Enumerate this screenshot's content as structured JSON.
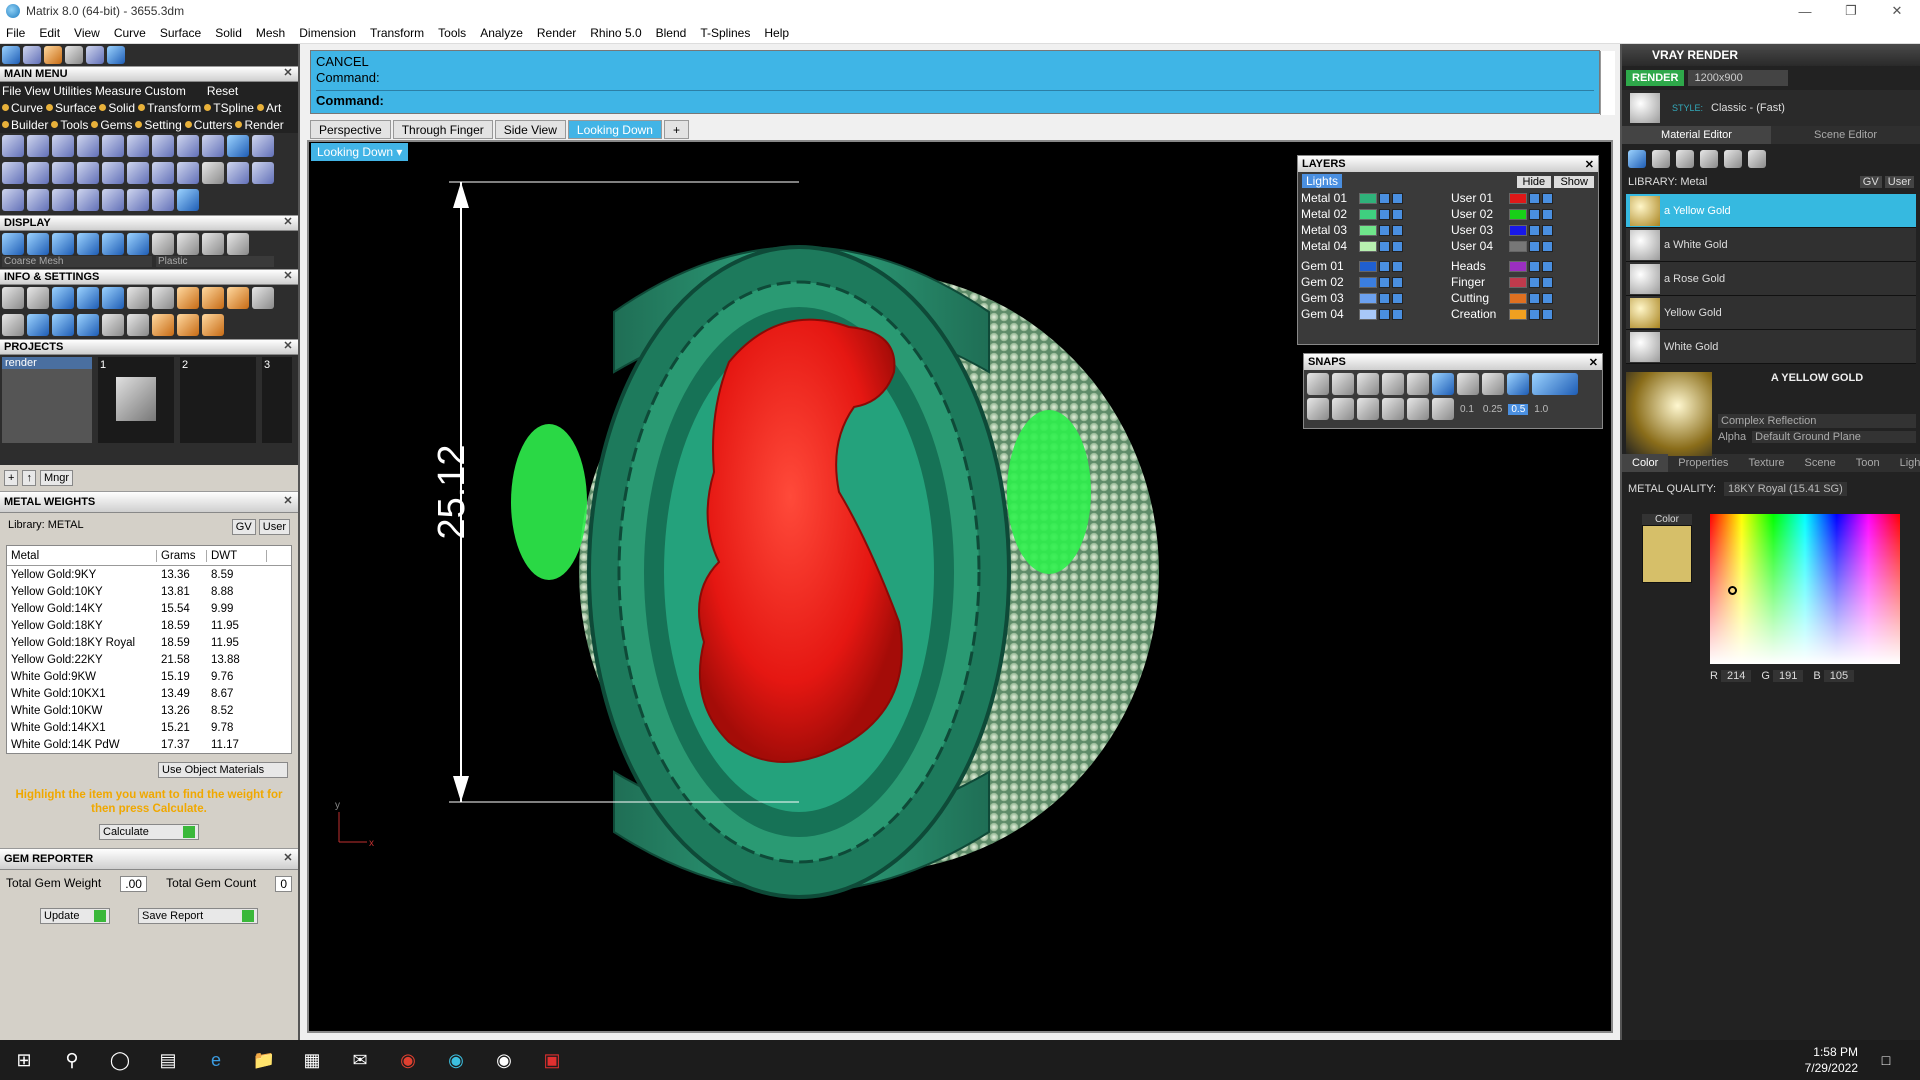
{
  "window": {
    "title": "Matrix 8.0 (64-bit) - 3655.3dm"
  },
  "menu": [
    "File",
    "Edit",
    "View",
    "Curve",
    "Surface",
    "Solid",
    "Mesh",
    "Dimension",
    "Transform",
    "Tools",
    "Analyze",
    "Render",
    "Rhino 5.0",
    "Blend",
    "T-Splines",
    "Help"
  ],
  "left": {
    "main_menu_title": "MAIN MENU",
    "main_menu_row1": [
      "File",
      "View",
      "Utilities",
      "Measure",
      "Custom",
      "Reset"
    ],
    "main_menu_row2": [
      "Curve",
      "Surface",
      "Solid",
      "Transform",
      "TSpline",
      "Art"
    ],
    "main_menu_row3": [
      "Builder",
      "Tools",
      "Gems",
      "Setting",
      "Cutters",
      "Render"
    ],
    "display_title": "DISPLAY",
    "display_mesh": "Coarse Mesh",
    "display_material": "Plastic",
    "info_title": "INFO & SETTINGS",
    "projects_title": "PROJECTS",
    "project_item": "render",
    "project_slots": [
      "1",
      "2",
      "3"
    ],
    "mngr_label": "Mngr",
    "metal_title": "METAL WEIGHTS",
    "library_label": "Library: METAL",
    "gv_label": "GV",
    "user_label": "User",
    "columns": [
      "Metal",
      "Grams",
      "DWT"
    ],
    "rows": [
      [
        "Yellow Gold:9KY",
        "13.36",
        "8.59"
      ],
      [
        "Yellow Gold:10KY",
        "13.81",
        "8.88"
      ],
      [
        "Yellow Gold:14KY",
        "15.54",
        "9.99"
      ],
      [
        "Yellow Gold:18KY",
        "18.59",
        "11.95"
      ],
      [
        "Yellow Gold:18KY Royal",
        "18.59",
        "11.95"
      ],
      [
        "Yellow Gold:22KY",
        "21.58",
        "13.88"
      ],
      [
        "White Gold:9KW",
        "15.19",
        "9.76"
      ],
      [
        "White Gold:10KX1",
        "13.49",
        "8.67"
      ],
      [
        "White Gold:10KW",
        "13.26",
        "8.52"
      ],
      [
        "White Gold:14KX1",
        "15.21",
        "9.78"
      ],
      [
        "White Gold:14K PdW",
        "17.37",
        "11.17"
      ]
    ],
    "use_object_materials": "Use Object Materials",
    "hint": "Highlight the item you want to find the weight for then press Calculate.",
    "calculate": "Calculate",
    "gem_title": "GEM REPORTER",
    "total_gem_weight_label": "Total Gem Weight",
    "total_gem_weight": ".00",
    "total_gem_count_label": "Total Gem Count",
    "total_gem_count": "0",
    "update": "Update",
    "save_report": "Save Report"
  },
  "command": {
    "line1": "CANCEL",
    "line2": "Command:",
    "prompt": "Command:"
  },
  "viewtabs": [
    "Perspective",
    "Through Finger",
    "Side View",
    "Looking Down"
  ],
  "active_view": "Looking Down",
  "viewport": {
    "dimension": "25.12",
    "axis_y": "y",
    "axis_x": "x"
  },
  "layers": {
    "title": "LAYERS",
    "lights": "Lights",
    "hide": "Hide",
    "show": "Show",
    "left": [
      {
        "name": "Metal 01",
        "color": "#2fb27a"
      },
      {
        "name": "Metal 02",
        "color": "#3fcf7f"
      },
      {
        "name": "Metal 03",
        "color": "#6fe58a"
      },
      {
        "name": "Metal 04",
        "color": "#b8f0b0"
      },
      {
        "name": "Gem 01",
        "color": "#1f5fd0"
      },
      {
        "name": "Gem 02",
        "color": "#3b7ee0"
      },
      {
        "name": "Gem 03",
        "color": "#6ca1ef"
      },
      {
        "name": "Gem 04",
        "color": "#a8c8f8"
      }
    ],
    "right": [
      {
        "name": "User 01",
        "color": "#e01818"
      },
      {
        "name": "User 02",
        "color": "#18d018"
      },
      {
        "name": "User 03",
        "color": "#1818e8"
      },
      {
        "name": "User 04",
        "color": "#777777"
      },
      {
        "name": "Heads",
        "color": "#9b2fc0"
      },
      {
        "name": "Finger",
        "color": "#c03a4c"
      },
      {
        "name": "Cutting",
        "color": "#e07020"
      },
      {
        "name": "Creation",
        "color": "#f0a020"
      }
    ]
  },
  "snaps": {
    "title": "SNAPS",
    "values": [
      "0.1",
      "0.25",
      "0.5",
      "1.0"
    ]
  },
  "vray": {
    "title": "VRAY RENDER",
    "render_btn": "RENDER",
    "resolution": "1200x900",
    "style_label": "STYLE:",
    "style_value": "Classic - (Fast)",
    "tabs": [
      "Material Editor",
      "Scene Editor"
    ],
    "library": "LIBRARY: Metal",
    "gv": "GV",
    "user": "User",
    "materials": [
      "a Yellow Gold",
      "a White Gold",
      "a Rose Gold",
      "Yellow Gold",
      "White Gold"
    ],
    "preview_name": "A YELLOW GOLD",
    "reflection": "Complex Reflection",
    "alpha": "Alpha",
    "ground": "Default Ground Plane",
    "subtabs": [
      "Color",
      "Properties",
      "Texture",
      "Scene",
      "Toon",
      "Light"
    ],
    "metal_quality_label": "METAL QUALITY:",
    "metal_quality": "18KY Royal    (15.41 SG)",
    "color_label": "Color",
    "rgb": {
      "R": "214",
      "G": "191",
      "B": "105"
    },
    "swatch": "#d6bf69"
  },
  "taskbar": {
    "time": "1:58 PM",
    "date": "7/29/2022"
  }
}
